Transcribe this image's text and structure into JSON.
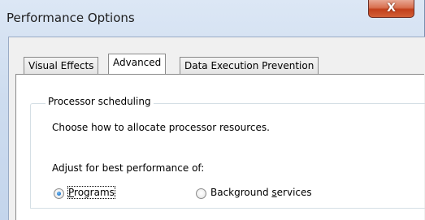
{
  "window": {
    "title": "Performance Options",
    "close_label": "X"
  },
  "tabs": [
    {
      "label": "Visual Effects",
      "active": false
    },
    {
      "label": "Advanced",
      "active": true
    },
    {
      "label": "Data Execution Prevention",
      "active": false
    }
  ],
  "processor_scheduling": {
    "group_title": "Processor scheduling",
    "description": "Choose how to allocate processor resources.",
    "adjust_label": "Adjust for best performance of:",
    "options": [
      {
        "label_underlined": "P",
        "label_rest": "rograms",
        "checked": true
      },
      {
        "label_prefix": "Background ",
        "label_underlined": "s",
        "label_rest": "ervices",
        "checked": false
      }
    ]
  }
}
